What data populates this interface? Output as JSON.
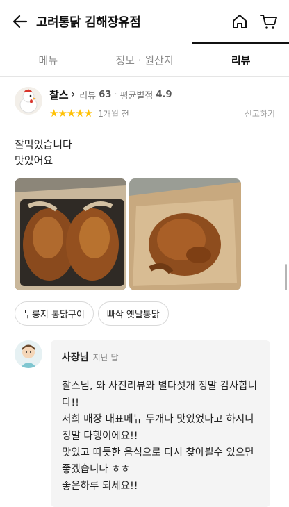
{
  "header": {
    "title": "고려통닭 김해장유점"
  },
  "tabs": [
    {
      "label": "메뉴",
      "active": false
    },
    {
      "label": "정보 · 원산지",
      "active": false
    },
    {
      "label": "리뷰",
      "active": true
    }
  ],
  "review": {
    "author": "찰스",
    "review_count_label": "리뷰",
    "review_count": "63",
    "avg_rating_label": "평균별점",
    "avg_rating": "4.9",
    "stars": "★★★★★",
    "rating": 5,
    "time_ago": "1개월 전",
    "report_label": "신고하기",
    "text": "잘먹었습니다\n맛있어요",
    "tags": [
      "누룽지 통닭구이",
      "빠삭 옛날통닭"
    ]
  },
  "owner_reply": {
    "name": "사장님",
    "time": "지난 달",
    "text": "찰스님, 와 사진리뷰와 별다섯개 정말 감사합니다!!\n저희 매장 대표메뉴 두개다 맛있었다고 하시니 정말 다행이에요!!\n맛있고 따듯한 음식으로 다시 찾아뵐수 있으면 좋겠습니다 ㅎㅎ\n좋은하루 되세요!!"
  },
  "colors": {
    "star": "#ffc107",
    "active_tab": "#111111",
    "reply_bg": "#f4f4f4"
  },
  "icons": [
    "back-arrow-icon",
    "home-icon",
    "cart-icon",
    "chevron-right-icon"
  ]
}
